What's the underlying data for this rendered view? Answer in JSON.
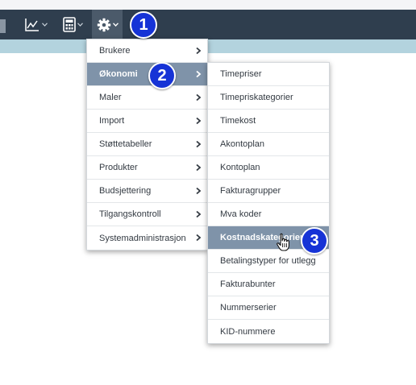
{
  "toolbar": {
    "buttons": [
      {
        "icon": "chart-icon"
      },
      {
        "icon": "calculator-icon"
      },
      {
        "icon": "gear-icon"
      }
    ]
  },
  "menu_main": {
    "items": [
      {
        "label": "Brukere"
      },
      {
        "label": "Økonomi",
        "highlighted": true
      },
      {
        "label": "Maler"
      },
      {
        "label": "Import"
      },
      {
        "label": "Støttetabeller"
      },
      {
        "label": "Produkter"
      },
      {
        "label": "Budsjettering"
      },
      {
        "label": "Tilgangskontroll"
      },
      {
        "label": "Systemadministrasjon"
      }
    ]
  },
  "menu_sub": {
    "items": [
      {
        "label": "Timepriser"
      },
      {
        "label": "Timepriskategorier"
      },
      {
        "label": "Timekost"
      },
      {
        "label": "Akontoplan"
      },
      {
        "label": "Kontoplan"
      },
      {
        "label": "Fakturagrupper"
      },
      {
        "label": "Mva koder"
      },
      {
        "label": "Kostnadskategorier",
        "highlighted": true
      },
      {
        "label": "Betalingstyper for utlegg"
      },
      {
        "label": "Fakturabunter"
      },
      {
        "label": "Nummerserier"
      },
      {
        "label": "KID-nummere"
      }
    ]
  },
  "badges": [
    "1",
    "2",
    "3"
  ],
  "colors": {
    "toolbar": "#2f3e4e",
    "subbar": "#b3d3de",
    "highlight": "#7f93a9",
    "badge": "#1633d6"
  }
}
